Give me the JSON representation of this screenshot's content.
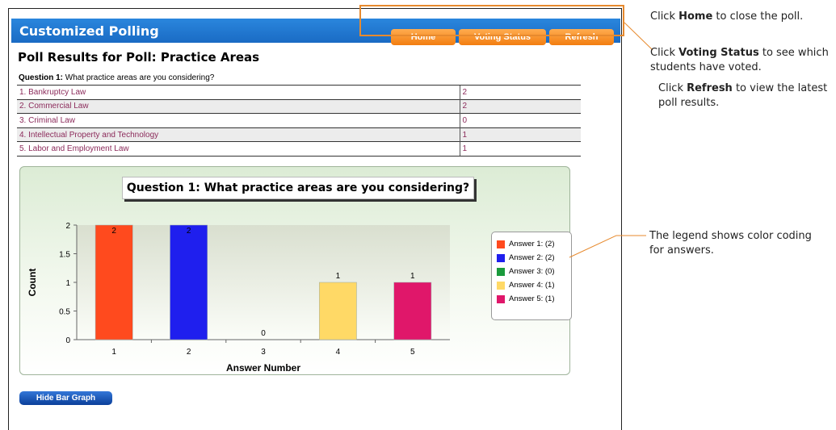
{
  "app": {
    "title": "Customized Polling",
    "nav": {
      "home": "Home",
      "voting_status": "Voting Status",
      "refresh": "Refresh"
    }
  },
  "poll": {
    "heading": "Poll Results for Poll: Practice Areas",
    "question_prefix": "Question 1:",
    "question_text": "What practice areas are you considering?",
    "rows": [
      {
        "answer": "1. Bankruptcy Law",
        "count": "2"
      },
      {
        "answer": "2. Commercial Law",
        "count": "2"
      },
      {
        "answer": "3. Criminal Law",
        "count": "0"
      },
      {
        "answer": "4. Intellectual Property and Technology",
        "count": "1"
      },
      {
        "answer": "5. Labor and Employment Law",
        "count": "1"
      }
    ]
  },
  "chart_data": {
    "type": "bar",
    "title": "Question 1: What practice areas are you considering?",
    "xlabel": "Answer Number",
    "ylabel": "Count",
    "categories": [
      "1",
      "2",
      "3",
      "4",
      "5"
    ],
    "values": [
      2,
      2,
      0,
      1,
      1
    ],
    "data_labels": [
      "2",
      "2",
      "0",
      "1",
      "1"
    ],
    "colors": [
      "#ff4a1e",
      "#1f1fee",
      "#1a9a3c",
      "#ffd966",
      "#e0176a"
    ],
    "ylim": [
      0,
      2
    ],
    "yticks": [
      "0",
      "0.5",
      "1",
      "1.5",
      "2"
    ],
    "legend_position": "right",
    "legend": [
      "Answer 1: (2)",
      "Answer 2: (2)",
      "Answer 3: (0)",
      "Answer 4: (1)",
      "Answer 5: (1)"
    ]
  },
  "controls": {
    "hide_graph": "Hide Bar Graph"
  },
  "callouts": {
    "home": {
      "pre": "Click ",
      "bold": "Home",
      "post": " to close the poll."
    },
    "voting": {
      "pre": "Click ",
      "bold": "Voting Status",
      "post": " to see which students have voted."
    },
    "refresh": {
      "pre": "Click ",
      "bold": "Refresh",
      "post": " to view the latest poll results."
    },
    "legend": {
      "text": "The legend shows color coding for answers."
    }
  }
}
